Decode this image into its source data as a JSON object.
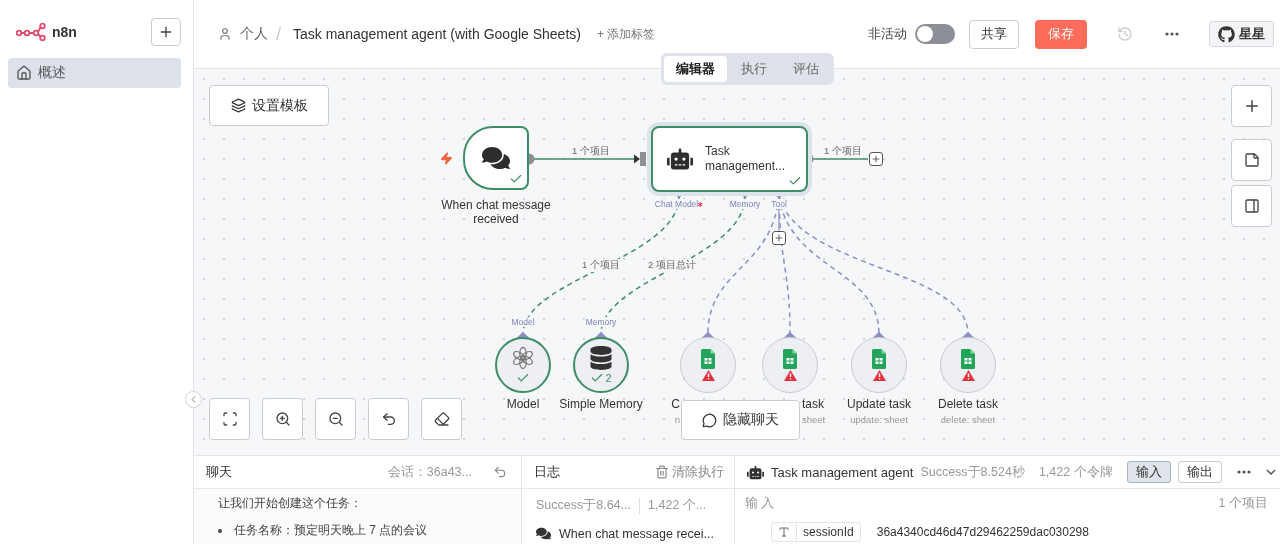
{
  "sidebar": {
    "logo": "n8n",
    "items": [
      {
        "label": "概述",
        "selected": true
      }
    ]
  },
  "header": {
    "owner": "个人",
    "separator": "/",
    "title": "Task management agent (with Google Sheets)",
    "add_tag": "+ 添加标签",
    "active_label": "非活动",
    "active": false,
    "share": "共享",
    "save": "保存",
    "star": "星星"
  },
  "view_tabs": [
    {
      "label": "编辑器",
      "selected": true
    },
    {
      "label": "执行",
      "selected": false
    },
    {
      "label": "评估",
      "selected": false
    }
  ],
  "canvas": {
    "template_button": "设置模板",
    "hide_chat": "隐藏聊天",
    "trigger": {
      "name": "When chat message received",
      "success": true
    },
    "agent": {
      "name": "Task management...",
      "success": true,
      "ports": [
        {
          "label": "Chat Model",
          "required": true
        },
        {
          "label": "Memory",
          "required": false
        },
        {
          "label": "Tool",
          "required": false
        }
      ]
    },
    "sub_nodes": [
      {
        "kind": "model",
        "name": "Model",
        "input_label": "Model",
        "warning": false
      },
      {
        "kind": "memory",
        "name": "Simple Memory",
        "input_label": "Memory",
        "warning": false,
        "badge": "2"
      },
      {
        "kind": "sheet",
        "name": "C",
        "subtitle": "n",
        "warning": true,
        "cut_right": true
      },
      {
        "kind": "sheet",
        "name": "task",
        "subtitle": "sheet",
        "warning": true,
        "cut_left": true
      },
      {
        "kind": "sheet",
        "name": "Update task",
        "subtitle": "update: sheet",
        "warning": true
      },
      {
        "kind": "sheet",
        "name": "Delete task",
        "subtitle": "delete: sheet",
        "warning": true
      }
    ],
    "edge_labels": [
      "1 个项目",
      "1 个项目",
      "1 个项目",
      "2 项目总计"
    ]
  },
  "chat_panel": {
    "title": "聊天",
    "session": "会话：36a43...",
    "messages": [
      {
        "kind": "text",
        "text": "让我们开始创建这个任务："
      },
      {
        "kind": "bullet",
        "text": "任务名称：预定明天晚上 7 点的会议"
      }
    ]
  },
  "log_panel": {
    "title": "日志",
    "clear": "清除执行",
    "status": "Success于8.64...",
    "tokens": "1,422 个...",
    "entries": [
      {
        "name": "When chat message recei..."
      }
    ]
  },
  "output_panel": {
    "title": "Task management agent",
    "status": "Success于8.524秒",
    "tokens": "1,422 个令牌",
    "views": [
      {
        "label": "输入",
        "selected": true
      },
      {
        "label": "输出",
        "selected": false
      }
    ],
    "section": "输 入",
    "count": "1 个项目",
    "fields": [
      {
        "name": "sessionId",
        "value": "36a4340cd46d47d29462259dac030298"
      }
    ]
  }
}
